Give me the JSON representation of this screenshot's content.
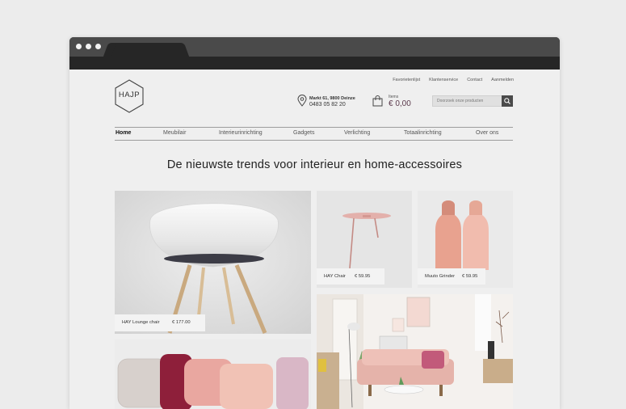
{
  "header": {
    "logo_text": "HAJP",
    "top_links": [
      "Favorietenlijst",
      "Klantenservice",
      "Contact",
      "Aanmelden"
    ],
    "address": {
      "line1": "Markt 61, 9800 Deinze",
      "phone": "0483 05 82 20"
    },
    "cart": {
      "label": "Items",
      "total": "€ 0,00"
    },
    "search": {
      "placeholder": "Doorzoek onze producten"
    }
  },
  "nav": {
    "items": [
      "Home",
      "Meubilair",
      "Interieurinrichting",
      "Gadgets",
      "Verlichting",
      "Totaalinrichting",
      "Over ons"
    ],
    "active": "Home"
  },
  "headline": "De nieuwste trends voor interieur en home-accessoires",
  "products": [
    {
      "name": "HAY Lounge chair",
      "price": "€ 177.00"
    },
    {
      "name": "HAY Chair",
      "price": "€ 59.95"
    },
    {
      "name": "Muuto Grinder",
      "price": "€ 59.95"
    }
  ],
  "colors": {
    "chrome": "#262626",
    "accent": "#5b3a4c",
    "page_bg": "#efefef"
  }
}
